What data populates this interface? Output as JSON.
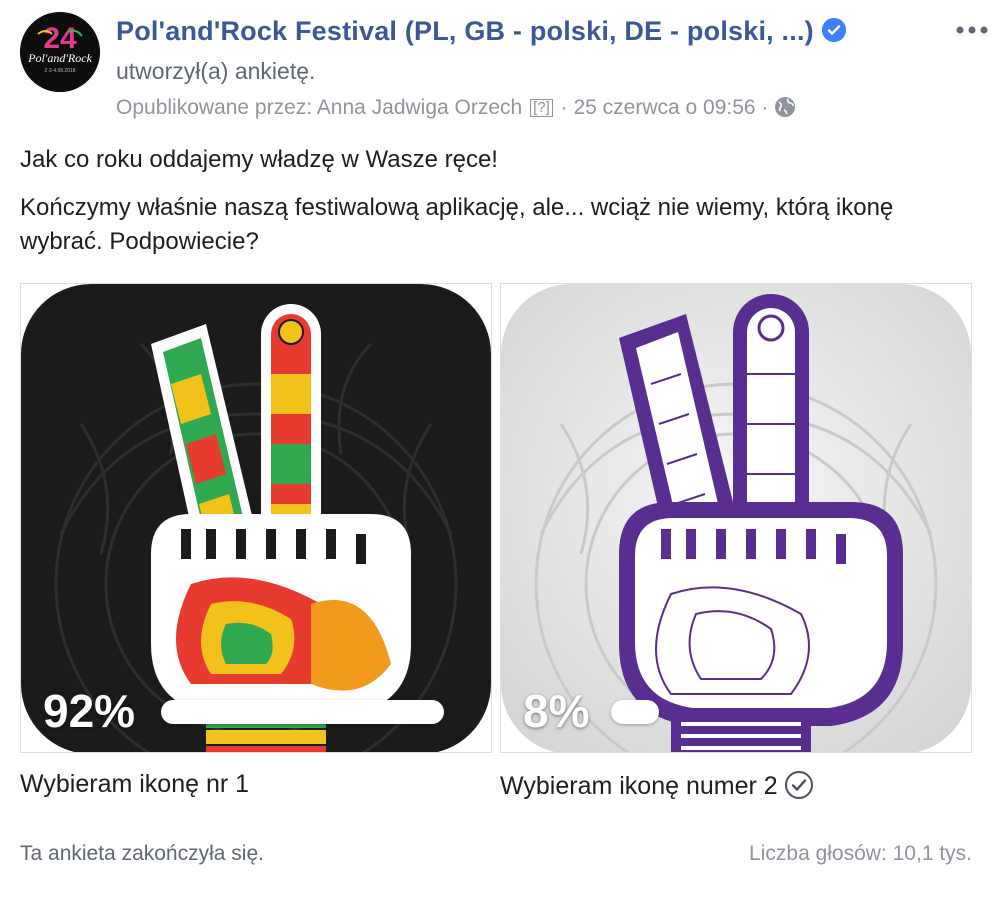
{
  "post": {
    "page_name": "Pol'and'Rock Festival (PL, GB - polski, DE - polski, ...)",
    "action": "utworzył(a) ankietę.",
    "published_by": "Opublikowane przez: Anna Jadwiga Orzech",
    "published_by_help": "[?]",
    "separator": "·",
    "date": "25 czerwca o 09:56",
    "audience_icon": "globe-icon",
    "verified_icon": "verified-badge-icon",
    "more_icon": "more-options-icon",
    "text_line1": "Jak co roku oddajemy władzę w Wasze ręce!",
    "text_line2": "Kończymy właśnie naszą festiwalową aplikację, ale... wciąż nie wiemy, którą ikonę wybrać. Podpowiecie?"
  },
  "avatar": {
    "logo_text_top": "24",
    "logo_text_mid": "Pol'and'Rock",
    "logo_text_bottom": "2·3·4.08.2018"
  },
  "poll": {
    "options": [
      {
        "label": "Wybieram ikonę nr 1",
        "percent_label": "92%",
        "percent": 92,
        "selected": false,
        "background": "#1b1b1b"
      },
      {
        "label": "Wybieram ikonę numer 2",
        "percent_label": "8%",
        "percent": 8,
        "selected": true,
        "background": "#e6e6e6"
      }
    ],
    "status": "Ta ankieta zakończyła się.",
    "votes": "Liczba głosów: 10,1 tys."
  },
  "colors": {
    "link_blue": "#3b5998",
    "verified_blue": "#4080ff",
    "purple": "#5a2d91"
  }
}
